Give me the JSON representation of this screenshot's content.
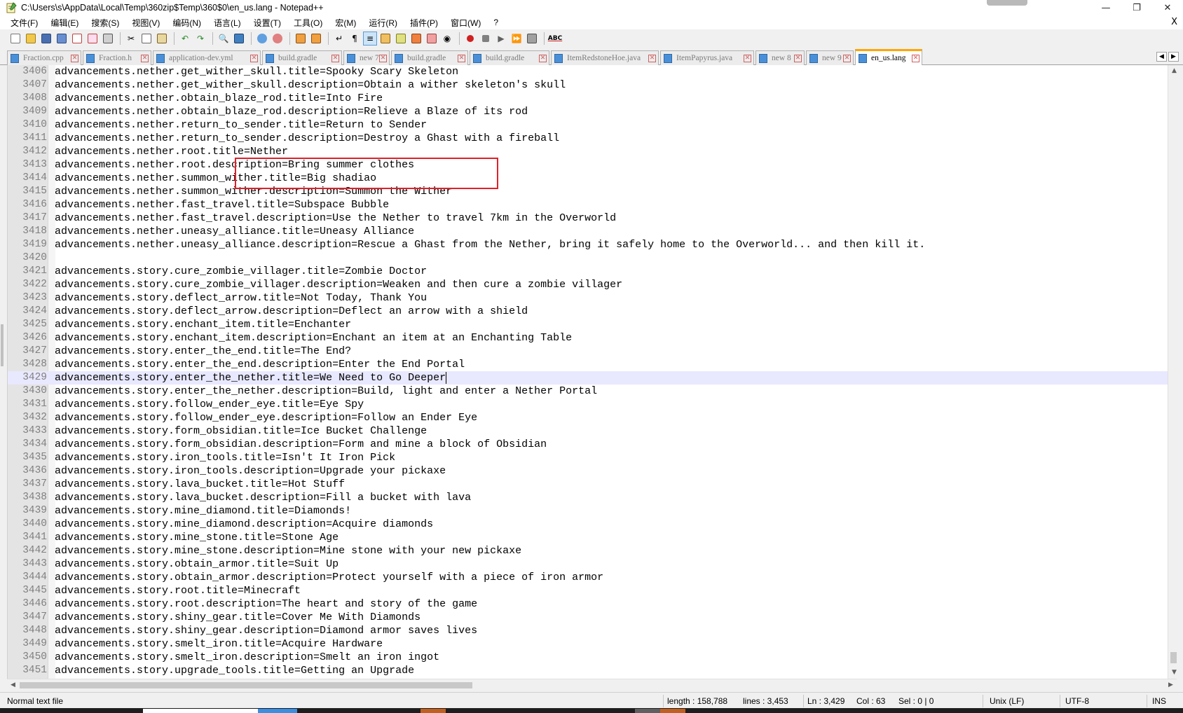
{
  "window": {
    "title": "C:\\Users\\s\\AppData\\Local\\Temp\\360zip$Temp\\360$0\\en_us.lang - Notepad++",
    "minimize_icon": "minimize-icon",
    "maximize_icon": "restore-icon",
    "close_icon": "close-icon"
  },
  "menu": [
    {
      "label": "文件(F)"
    },
    {
      "label": "编辑(E)"
    },
    {
      "label": "搜索(S)"
    },
    {
      "label": "视图(V)"
    },
    {
      "label": "编码(N)"
    },
    {
      "label": "语言(L)"
    },
    {
      "label": "设置(T)"
    },
    {
      "label": "工具(O)"
    },
    {
      "label": "宏(M)"
    },
    {
      "label": "运行(R)"
    },
    {
      "label": "插件(P)"
    },
    {
      "label": "窗口(W)"
    },
    {
      "label": "?"
    }
  ],
  "menu_close": "X",
  "tabs": [
    {
      "label": "Fraction.cpp",
      "active": false
    },
    {
      "label": "Fraction.h",
      "active": false
    },
    {
      "label": "application-dev.yml",
      "active": false
    },
    {
      "label": "build.gradle",
      "active": false
    },
    {
      "label": "new 7",
      "active": false
    },
    {
      "label": "build.gradle",
      "active": false
    },
    {
      "label": "build.gradle",
      "active": false
    },
    {
      "label": "ItemRedstoneHoe.java",
      "active": false
    },
    {
      "label": "ItemPapyrus.java",
      "active": false
    },
    {
      "label": "new 8",
      "active": false
    },
    {
      "label": "new 9",
      "active": false
    },
    {
      "label": "en_us.lang",
      "active": true
    }
  ],
  "editor": {
    "current_line": "3429",
    "lines": [
      {
        "n": "3406",
        "t": "advancements.nether.get_wither_skull.title=Spooky Scary Skeleton"
      },
      {
        "n": "3407",
        "t": "advancements.nether.get_wither_skull.description=Obtain a wither skeleton's skull"
      },
      {
        "n": "3408",
        "t": "advancements.nether.obtain_blaze_rod.title=Into Fire"
      },
      {
        "n": "3409",
        "t": "advancements.nether.obtain_blaze_rod.description=Relieve a Blaze of its rod"
      },
      {
        "n": "3410",
        "t": "advancements.nether.return_to_sender.title=Return to Sender"
      },
      {
        "n": "3411",
        "t": "advancements.nether.return_to_sender.description=Destroy a Ghast with a fireball"
      },
      {
        "n": "3412",
        "t": "advancements.nether.root.title=Nether"
      },
      {
        "n": "3413",
        "t": "advancements.nether.root.description=Bring summer clothes"
      },
      {
        "n": "3414",
        "t": "advancements.nether.summon_wither.title=Big shadiao"
      },
      {
        "n": "3415",
        "t": "advancements.nether.summon_wither.description=Summon the Wither"
      },
      {
        "n": "3416",
        "t": "advancements.nether.fast_travel.title=Subspace Bubble"
      },
      {
        "n": "3417",
        "t": "advancements.nether.fast_travel.description=Use the Nether to travel 7km in the Overworld"
      },
      {
        "n": "3418",
        "t": "advancements.nether.uneasy_alliance.title=Uneasy Alliance"
      },
      {
        "n": "3419",
        "t": "advancements.nether.uneasy_alliance.description=Rescue a Ghast from the Nether, bring it safely home to the Overworld... and then kill it."
      },
      {
        "n": "3420",
        "t": ""
      },
      {
        "n": "3421",
        "t": "advancements.story.cure_zombie_villager.title=Zombie Doctor"
      },
      {
        "n": "3422",
        "t": "advancements.story.cure_zombie_villager.description=Weaken and then cure a zombie villager"
      },
      {
        "n": "3423",
        "t": "advancements.story.deflect_arrow.title=Not Today, Thank You"
      },
      {
        "n": "3424",
        "t": "advancements.story.deflect_arrow.description=Deflect an arrow with a shield"
      },
      {
        "n": "3425",
        "t": "advancements.story.enchant_item.title=Enchanter"
      },
      {
        "n": "3426",
        "t": "advancements.story.enchant_item.description=Enchant an item at an Enchanting Table"
      },
      {
        "n": "3427",
        "t": "advancements.story.enter_the_end.title=The End?"
      },
      {
        "n": "3428",
        "t": "advancements.story.enter_the_end.description=Enter the End Portal"
      },
      {
        "n": "3429",
        "t": "advancements.story.enter_the_nether.title=We Need to Go Deeper"
      },
      {
        "n": "3430",
        "t": "advancements.story.enter_the_nether.description=Build, light and enter a Nether Portal"
      },
      {
        "n": "3431",
        "t": "advancements.story.follow_ender_eye.title=Eye Spy"
      },
      {
        "n": "3432",
        "t": "advancements.story.follow_ender_eye.description=Follow an Ender Eye"
      },
      {
        "n": "3433",
        "t": "advancements.story.form_obsidian.title=Ice Bucket Challenge"
      },
      {
        "n": "3434",
        "t": "advancements.story.form_obsidian.description=Form and mine a block of Obsidian"
      },
      {
        "n": "3435",
        "t": "advancements.story.iron_tools.title=Isn't It Iron Pick"
      },
      {
        "n": "3436",
        "t": "advancements.story.iron_tools.description=Upgrade your pickaxe"
      },
      {
        "n": "3437",
        "t": "advancements.story.lava_bucket.title=Hot Stuff"
      },
      {
        "n": "3438",
        "t": "advancements.story.lava_bucket.description=Fill a bucket with lava"
      },
      {
        "n": "3439",
        "t": "advancements.story.mine_diamond.title=Diamonds!"
      },
      {
        "n": "3440",
        "t": "advancements.story.mine_diamond.description=Acquire diamonds"
      },
      {
        "n": "3441",
        "t": "advancements.story.mine_stone.title=Stone Age"
      },
      {
        "n": "3442",
        "t": "advancements.story.mine_stone.description=Mine stone with your new pickaxe"
      },
      {
        "n": "3443",
        "t": "advancements.story.obtain_armor.title=Suit Up"
      },
      {
        "n": "3444",
        "t": "advancements.story.obtain_armor.description=Protect yourself with a piece of iron armor"
      },
      {
        "n": "3445",
        "t": "advancements.story.root.title=Minecraft"
      },
      {
        "n": "3446",
        "t": "advancements.story.root.description=The heart and story of the game"
      },
      {
        "n": "3447",
        "t": "advancements.story.shiny_gear.title=Cover Me With Diamonds"
      },
      {
        "n": "3448",
        "t": "advancements.story.shiny_gear.description=Diamond armor saves lives"
      },
      {
        "n": "3449",
        "t": "advancements.story.smelt_iron.title=Acquire Hardware"
      },
      {
        "n": "3450",
        "t": "advancements.story.smelt_iron.description=Smelt an iron ingot"
      },
      {
        "n": "3451",
        "t": "advancements.story.upgrade_tools.title=Getting an Upgrade"
      }
    ]
  },
  "status": {
    "file_type": "Normal text file",
    "length": "length : 158,788",
    "lines": "lines : 3,453",
    "ln": "Ln : 3,429",
    "col": "Col : 63",
    "sel": "Sel : 0 | 0",
    "eol": "Unix (LF)",
    "encoding": "UTF-8",
    "mode": "INS"
  },
  "toolbar_icons": [
    "new-file-icon",
    "open-file-icon",
    "save-icon",
    "save-all-icon",
    "close-icon",
    "close-all-icon",
    "print-icon",
    "cut-icon",
    "copy-icon",
    "paste-icon",
    "undo-icon",
    "redo-icon",
    "find-icon",
    "replace-icon",
    "zoom-in-icon",
    "zoom-out-icon",
    "sync-v-icon",
    "sync-h-icon",
    "word-wrap-icon",
    "show-all-chars-icon",
    "indent-guide-icon",
    "udl-icon",
    "doc-map-icon",
    "function-list-icon",
    "folder-workspace-icon",
    "monitor-icon",
    "record-macro-icon",
    "stop-macro-icon",
    "play-macro-icon",
    "run-macro-icon",
    "save-macro-icon",
    "spell-check-icon"
  ],
  "colors": {
    "highlight_box": "#e0202a",
    "active_tab_accent": "#ffa500",
    "current_line_bg": "#e8e8ff"
  }
}
